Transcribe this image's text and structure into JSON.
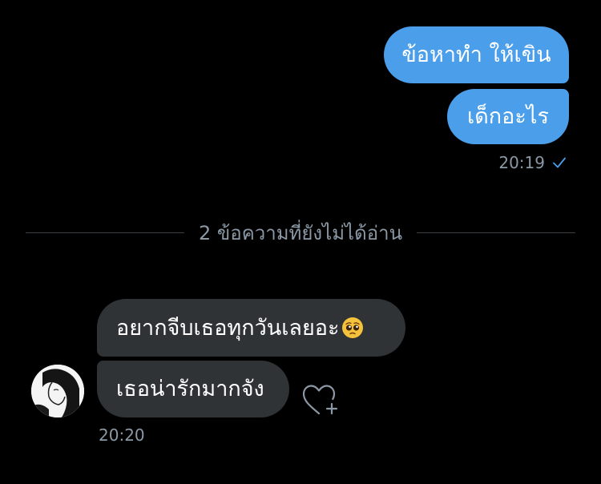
{
  "conversation": {
    "sent_messages": [
      {
        "text": "ข้อหาทำ ให้เขิน"
      },
      {
        "text": "เด็กอะไร"
      }
    ],
    "sent_time": "20:19",
    "sent_status_icon": "check-icon",
    "unread_divider": "2 ข้อความที่ยังไม่ได้อ่าน",
    "received_messages": [
      {
        "text": "อยากจีบเธอทุกวันเลยอะ",
        "emoji": "pleading-face-emoji"
      },
      {
        "text": "เธอน่ารักมากจัง"
      }
    ],
    "received_time": "20:20",
    "reaction_icon": "heart-plus-icon"
  },
  "colors": {
    "background": "#000000",
    "sent_bubble": "#4a9eea",
    "received_bubble": "#2f3336",
    "meta_text": "#8b98a5"
  }
}
